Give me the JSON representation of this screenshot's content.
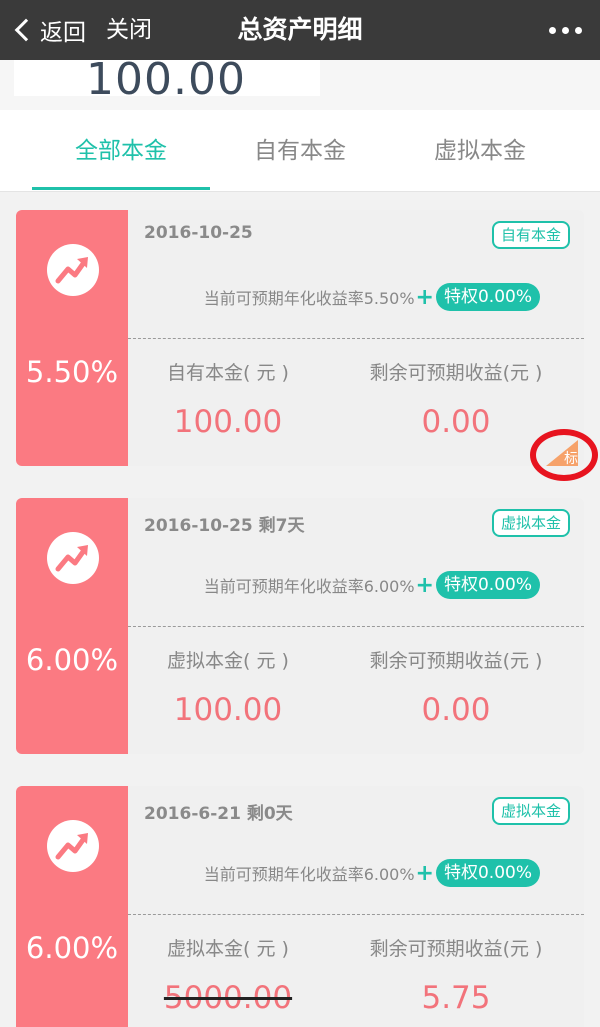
{
  "navbar": {
    "back_label": "返回",
    "close_label": "关闭",
    "title": "总资产明细"
  },
  "summary": {
    "amount": "100.00"
  },
  "tabs": [
    {
      "label": "全部本金",
      "active": true
    },
    {
      "label": "自有本金",
      "active": false
    },
    {
      "label": "虚拟本金",
      "active": false
    }
  ],
  "cards": [
    {
      "rate": "5.50%",
      "date": "2016-10-25",
      "tag": "自有本金",
      "yield_text": "当前可预期年化收益率5.50%",
      "privilege": "特权0.00%",
      "principal_label": "自有本金( 元 )",
      "principal_value": "100.00",
      "income_label": "剩余可预期收益(元 )",
      "income_value": "0.00",
      "badge": "标"
    },
    {
      "rate": "6.00%",
      "date": "2016-10-25 剩7天",
      "tag": "虚拟本金",
      "yield_text": "当前可预期年化收益率6.00%",
      "privilege": "特权0.00%",
      "principal_label": "虚拟本金( 元 )",
      "principal_value": "100.00",
      "income_label": "剩余可预期收益(元 )",
      "income_value": "0.00"
    },
    {
      "rate": "6.00%",
      "date": "2016-6-21 剩0天",
      "tag": "虚拟本金",
      "yield_text": "当前可预期年化收益率6.00%",
      "privilege": "特权0.00%",
      "principal_label": "虚拟本金( 元 )",
      "principal_value": "5000.00",
      "income_label": "剩余可预期收益(元 )",
      "income_value": "5.75"
    }
  ],
  "colors": {
    "accent": "#1fc1aa",
    "card_left": "#fb7a82",
    "value_red": "#f2737b",
    "navbar": "#3a3a3a",
    "annotation_ring": "#e7141f"
  },
  "icons": {
    "back": "chevron-left-icon",
    "more": "more-dots-icon",
    "card": "trend-up-icon",
    "badge": "bid-corner-badge-icon"
  }
}
